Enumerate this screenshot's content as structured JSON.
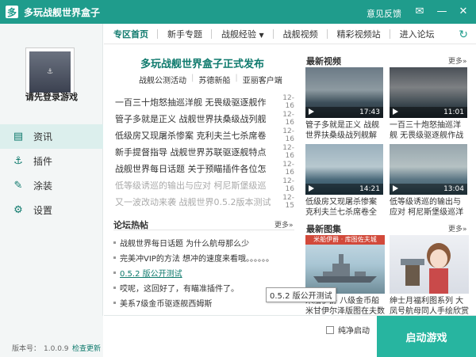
{
  "window": {
    "title": "多玩战舰世界盒子",
    "logo": "多",
    "feedback": "意见反馈",
    "buttons": [
      "skin-icon",
      "minimize-icon",
      "close-icon"
    ]
  },
  "sidebar": {
    "login_text": "请先登录游戏",
    "items": [
      {
        "label": "资讯",
        "icon": "news-icon"
      },
      {
        "label": "插件",
        "icon": "anchor-icon"
      },
      {
        "label": "涂装",
        "icon": "paint-icon"
      },
      {
        "label": "设置",
        "icon": "gear-icon"
      }
    ]
  },
  "tabs": [
    "专区首页",
    "新手专题",
    "战舰经验",
    "战舰视频",
    "精彩视频站",
    "进入论坛"
  ],
  "headline": {
    "title": "多玩战舰世界盒子正式发布",
    "subs": [
      "战舰公测活动",
      "苏德新船",
      "亚丽客户端"
    ]
  },
  "news": [
    {
      "text": "一百三十炮怒抽巡洋舰 无畏级驱逐舰作",
      "date": "12-16"
    },
    {
      "text": "管子多就是正义 战舰世界扶桑级战列舰",
      "date": "12-16"
    },
    {
      "text": "低级房又现屠杀惨案 克利夫兰七杀席卷",
      "date": "12-16"
    },
    {
      "text": "新手提督指导 战舰世界苏联驱逐舰特点",
      "date": "12-16"
    },
    {
      "text": "战舰世界每日话题 关于预瞄插件各位怎",
      "date": "12-16"
    },
    {
      "text": "低等级诱巡的输出与应对 柯尼斯堡级巡",
      "date": "12-16"
    },
    {
      "text": "又一波改动来袭 战舰世界0.5.2版本测试",
      "date": "12-15"
    }
  ],
  "forum": {
    "title": "论坛热帖",
    "more": "更多»",
    "items": [
      "战舰世界每日话题 为什么航母那么少",
      "完美冲VIP的方法 想冲的速度来看哦。。。。。。",
      "0.5.2 版公开测试",
      "哎呢，这回好了，有瞄准插件了。",
      "美系7级金币驱逐舰西姆斯"
    ]
  },
  "videos": {
    "title": "最新视频",
    "more": "更多»",
    "items": [
      {
        "duration": "17:43",
        "caption": "管子多就是正义 战舰世界扶桑级战列舰解说"
      },
      {
        "duration": "11:01",
        "caption": "一百三十炮怒抽巡洋舰 无畏级驱逐舰作战"
      },
      {
        "duration": "14:21",
        "caption": "低级房又现屠杀惨案 克利夫兰七杀席卷全场"
      },
      {
        "duration": "13:04",
        "caption": "低等级诱巡的输出与应对 柯尼斯堡级巡洋舰"
      }
    ]
  },
  "pictures": {
    "title": "最新图集",
    "more": "更多»",
    "items": [
      {
        "caption": "米船伊爵 八级金币船米甘伊尔泽版图在夫数据",
        "banner": "米船伊爵 · 库图佐夫城"
      },
      {
        "caption": "绅士月福利图系列 大凤号航母同人手绘欣赏"
      }
    ]
  },
  "tooltip": "0.5.2 版公开测试",
  "footer": {
    "version_label": "版本号：",
    "version": "1.0.0.9",
    "check_update": "检查更新",
    "pure_start": "纯净启动",
    "launch": "启动游戏"
  },
  "colors": {
    "accent": "#1f9c8c",
    "link": "#0f7a6d",
    "launch": "#27b5a0"
  }
}
